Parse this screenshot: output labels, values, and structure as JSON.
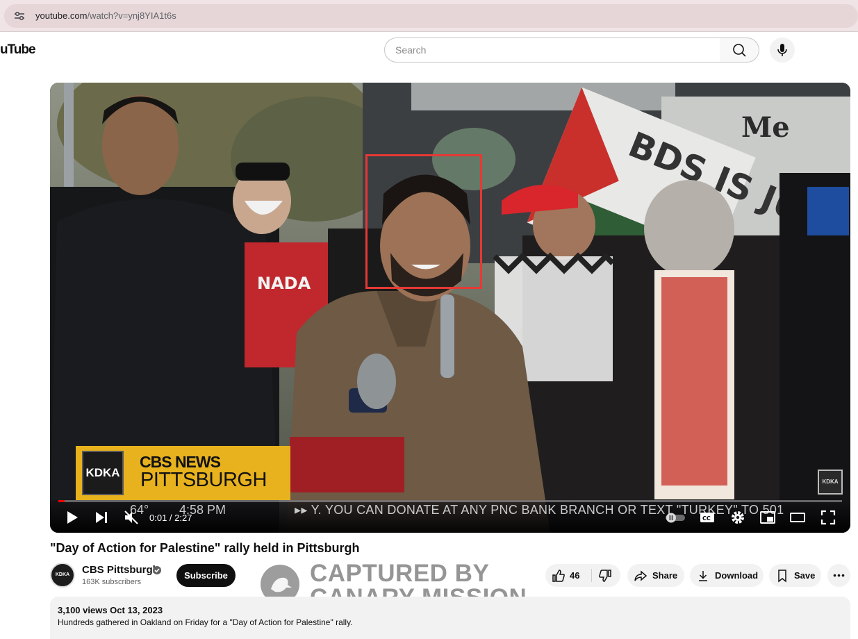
{
  "browser": {
    "url_host": "youtube.com",
    "url_path": "/watch?v=ynj8YIA1t6s"
  },
  "header": {
    "logo_text": "uTube",
    "search_placeholder": "Search"
  },
  "player": {
    "lower_third": {
      "station": "KDKA",
      "network": "CBS NEWS",
      "city": "PITTSBURGH"
    },
    "ticker": {
      "temperature": "64°",
      "clock": "4:58 PM",
      "crawl": "Y. YOU CAN DONATE AT ANY PNC BANK BRANCH OR TEXT \"TURKEY\" TO 501"
    },
    "sign_text": "BDS IS JUSTICE",
    "sign_text_bg": "Me",
    "shirt_text": "NADA",
    "bug": "KDKA",
    "time_current": "0:01",
    "time_total": "2:27",
    "time_display": "0:01 / 2:27",
    "progress_fraction": 0.007
  },
  "video": {
    "title": "\"Day of Action for Palestine\" rally held in Pittsburgh"
  },
  "channel": {
    "name": "CBS Pittsburgh",
    "subscribers": "163K subscribers",
    "avatar_text": "KDKA",
    "subscribe_label": "Subscribe"
  },
  "actions": {
    "like_count": "46",
    "share_label": "Share",
    "download_label": "Download",
    "save_label": "Save"
  },
  "watermark": {
    "line1": "CAPTURED BY",
    "line2": "CANARY MISSION"
  },
  "description": {
    "meta": "3,100 views  Oct 13, 2023",
    "text": "Hundreds gathered in Oakland on Friday for a \"Day of Action for Palestine\" rally."
  },
  "colors": {
    "accent_red": "#ff0000",
    "highlight_box": "#e53935",
    "cbs_yellow": "#e7b21d"
  }
}
